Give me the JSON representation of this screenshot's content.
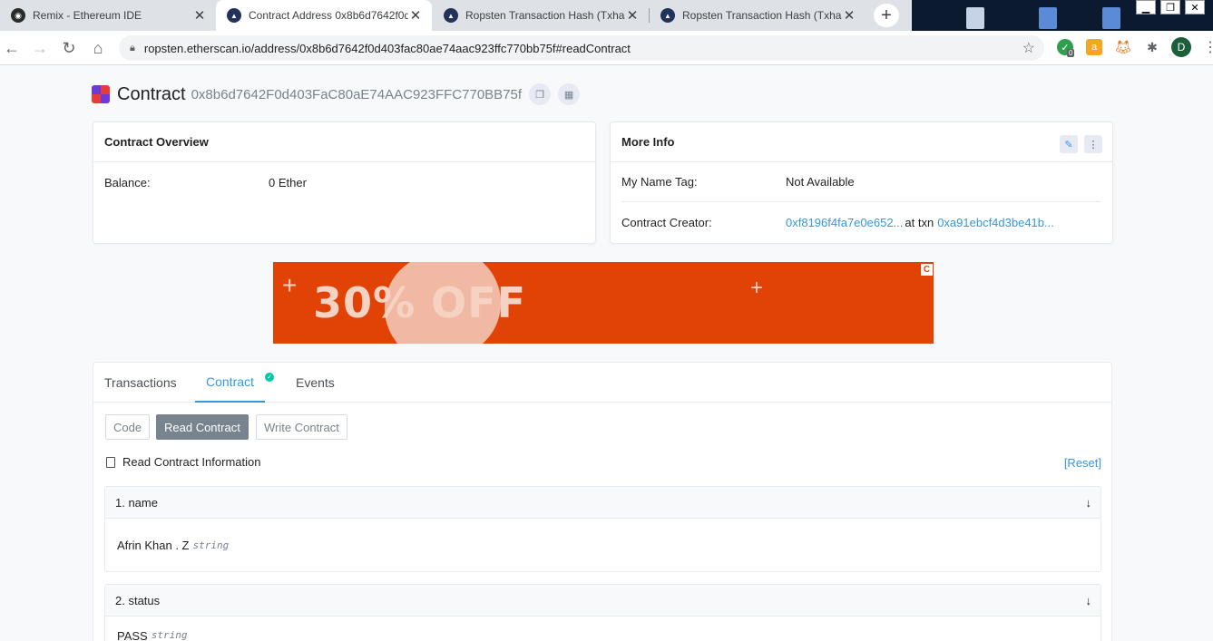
{
  "browser": {
    "tabs": [
      {
        "title": "Remix - Ethereum IDE",
        "active": false
      },
      {
        "title": "Contract Address 0x8b6d7642f0d",
        "active": true
      },
      {
        "title": "Ropsten Transaction Hash (Txhas",
        "active": false
      },
      {
        "title": "Ropsten Transaction Hash (Txhas",
        "active": false
      }
    ],
    "url": "ropsten.etherscan.io/address/0x8b6d7642f0d403fac80ae74aac923ffc770bb75f#readContract",
    "extension_badge": "0",
    "profile_initial": "D"
  },
  "header": {
    "title": "Contract",
    "address": "0x8b6d7642F0d403FaC80aE74AAC923FFC770BB75f"
  },
  "overview": {
    "title": "Contract Overview",
    "balance_label": "Balance:",
    "balance_value": "0 Ether"
  },
  "more_info": {
    "title": "More Info",
    "name_tag_label": "My Name Tag:",
    "name_tag_value": "Not Available",
    "creator_label": "Contract Creator:",
    "creator_address": "0xf8196f4fa7e0e652...",
    "creator_at_txn": "at txn",
    "creator_txn": "0xa91ebcf4d3be41b..."
  },
  "banner": {
    "headline": "30% OFF",
    "badge": "C"
  },
  "tabs": {
    "transactions": "Transactions",
    "contract": "Contract",
    "events": "Events"
  },
  "contract_buttons": {
    "code": "Code",
    "read": "Read Contract",
    "write": "Write Contract"
  },
  "read_info": {
    "title": "Read Contract Information",
    "reset": "[Reset]"
  },
  "functions": [
    {
      "label": "1. name",
      "value": "Afrin Khan . Z",
      "type": "string"
    },
    {
      "label": "2. status",
      "value": "PASS",
      "type": "string"
    }
  ],
  "colors": {
    "accent": "#3498db",
    "banner": "#e14307",
    "verified": "#00c9a7"
  }
}
